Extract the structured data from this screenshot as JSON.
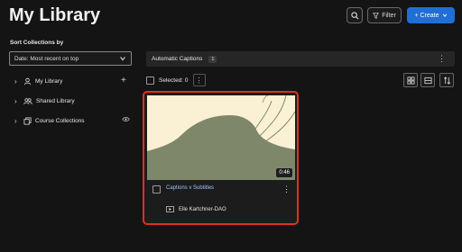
{
  "header": {
    "title": "My Library",
    "filter_label": "Filter",
    "create_label": "+ Create",
    "create_color": "#1f6fd6"
  },
  "sidebar": {
    "sort_label": "Sort Collections by",
    "sort_value": "Date: Most recent on top",
    "items": [
      {
        "label": "My Library",
        "icon": "user-icon"
      },
      {
        "label": "Shared Library",
        "icon": "users-icon"
      },
      {
        "label": "Course Collections",
        "icon": "collections-icon"
      }
    ]
  },
  "collection_bar": {
    "label": "Automatic Captions",
    "count": "1"
  },
  "selection": {
    "label": "Selected: 0"
  },
  "card": {
    "title": "Captions v Subtitles",
    "duration": "0:46",
    "owner": "Elle Kartchner-DAO",
    "highlight_color": "#e0301e"
  }
}
